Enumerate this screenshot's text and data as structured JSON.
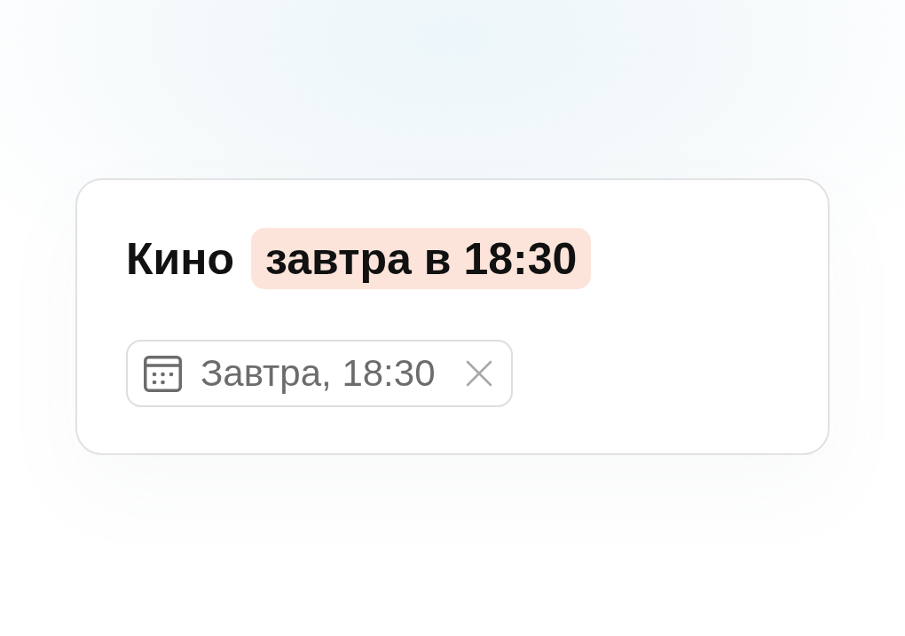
{
  "task": {
    "parts": [
      {
        "text": "Кино",
        "highlighted": false
      },
      {
        "text": "завтра в 18:30",
        "highlighted": true
      }
    ]
  },
  "date_chip": {
    "label": "Завтра, 18:30"
  }
}
